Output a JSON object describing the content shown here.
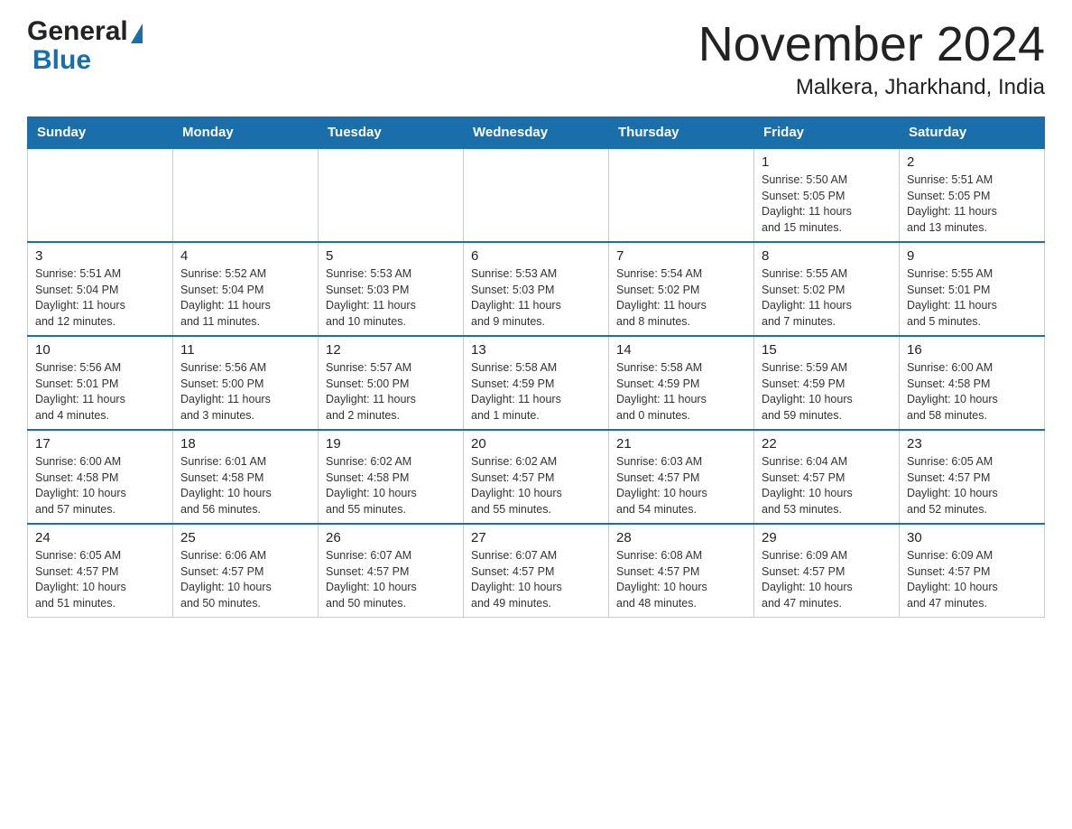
{
  "header": {
    "logo_general": "General",
    "logo_blue": "Blue",
    "main_title": "November 2024",
    "subtitle": "Malkera, Jharkhand, India"
  },
  "weekdays": [
    "Sunday",
    "Monday",
    "Tuesday",
    "Wednesday",
    "Thursday",
    "Friday",
    "Saturday"
  ],
  "weeks": [
    [
      {
        "day": "",
        "info": ""
      },
      {
        "day": "",
        "info": ""
      },
      {
        "day": "",
        "info": ""
      },
      {
        "day": "",
        "info": ""
      },
      {
        "day": "",
        "info": ""
      },
      {
        "day": "1",
        "info": "Sunrise: 5:50 AM\nSunset: 5:05 PM\nDaylight: 11 hours\nand 15 minutes."
      },
      {
        "day": "2",
        "info": "Sunrise: 5:51 AM\nSunset: 5:05 PM\nDaylight: 11 hours\nand 13 minutes."
      }
    ],
    [
      {
        "day": "3",
        "info": "Sunrise: 5:51 AM\nSunset: 5:04 PM\nDaylight: 11 hours\nand 12 minutes."
      },
      {
        "day": "4",
        "info": "Sunrise: 5:52 AM\nSunset: 5:04 PM\nDaylight: 11 hours\nand 11 minutes."
      },
      {
        "day": "5",
        "info": "Sunrise: 5:53 AM\nSunset: 5:03 PM\nDaylight: 11 hours\nand 10 minutes."
      },
      {
        "day": "6",
        "info": "Sunrise: 5:53 AM\nSunset: 5:03 PM\nDaylight: 11 hours\nand 9 minutes."
      },
      {
        "day": "7",
        "info": "Sunrise: 5:54 AM\nSunset: 5:02 PM\nDaylight: 11 hours\nand 8 minutes."
      },
      {
        "day": "8",
        "info": "Sunrise: 5:55 AM\nSunset: 5:02 PM\nDaylight: 11 hours\nand 7 minutes."
      },
      {
        "day": "9",
        "info": "Sunrise: 5:55 AM\nSunset: 5:01 PM\nDaylight: 11 hours\nand 5 minutes."
      }
    ],
    [
      {
        "day": "10",
        "info": "Sunrise: 5:56 AM\nSunset: 5:01 PM\nDaylight: 11 hours\nand 4 minutes."
      },
      {
        "day": "11",
        "info": "Sunrise: 5:56 AM\nSunset: 5:00 PM\nDaylight: 11 hours\nand 3 minutes."
      },
      {
        "day": "12",
        "info": "Sunrise: 5:57 AM\nSunset: 5:00 PM\nDaylight: 11 hours\nand 2 minutes."
      },
      {
        "day": "13",
        "info": "Sunrise: 5:58 AM\nSunset: 4:59 PM\nDaylight: 11 hours\nand 1 minute."
      },
      {
        "day": "14",
        "info": "Sunrise: 5:58 AM\nSunset: 4:59 PM\nDaylight: 11 hours\nand 0 minutes."
      },
      {
        "day": "15",
        "info": "Sunrise: 5:59 AM\nSunset: 4:59 PM\nDaylight: 10 hours\nand 59 minutes."
      },
      {
        "day": "16",
        "info": "Sunrise: 6:00 AM\nSunset: 4:58 PM\nDaylight: 10 hours\nand 58 minutes."
      }
    ],
    [
      {
        "day": "17",
        "info": "Sunrise: 6:00 AM\nSunset: 4:58 PM\nDaylight: 10 hours\nand 57 minutes."
      },
      {
        "day": "18",
        "info": "Sunrise: 6:01 AM\nSunset: 4:58 PM\nDaylight: 10 hours\nand 56 minutes."
      },
      {
        "day": "19",
        "info": "Sunrise: 6:02 AM\nSunset: 4:58 PM\nDaylight: 10 hours\nand 55 minutes."
      },
      {
        "day": "20",
        "info": "Sunrise: 6:02 AM\nSunset: 4:57 PM\nDaylight: 10 hours\nand 55 minutes."
      },
      {
        "day": "21",
        "info": "Sunrise: 6:03 AM\nSunset: 4:57 PM\nDaylight: 10 hours\nand 54 minutes."
      },
      {
        "day": "22",
        "info": "Sunrise: 6:04 AM\nSunset: 4:57 PM\nDaylight: 10 hours\nand 53 minutes."
      },
      {
        "day": "23",
        "info": "Sunrise: 6:05 AM\nSunset: 4:57 PM\nDaylight: 10 hours\nand 52 minutes."
      }
    ],
    [
      {
        "day": "24",
        "info": "Sunrise: 6:05 AM\nSunset: 4:57 PM\nDaylight: 10 hours\nand 51 minutes."
      },
      {
        "day": "25",
        "info": "Sunrise: 6:06 AM\nSunset: 4:57 PM\nDaylight: 10 hours\nand 50 minutes."
      },
      {
        "day": "26",
        "info": "Sunrise: 6:07 AM\nSunset: 4:57 PM\nDaylight: 10 hours\nand 50 minutes."
      },
      {
        "day": "27",
        "info": "Sunrise: 6:07 AM\nSunset: 4:57 PM\nDaylight: 10 hours\nand 49 minutes."
      },
      {
        "day": "28",
        "info": "Sunrise: 6:08 AM\nSunset: 4:57 PM\nDaylight: 10 hours\nand 48 minutes."
      },
      {
        "day": "29",
        "info": "Sunrise: 6:09 AM\nSunset: 4:57 PM\nDaylight: 10 hours\nand 47 minutes."
      },
      {
        "day": "30",
        "info": "Sunrise: 6:09 AM\nSunset: 4:57 PM\nDaylight: 10 hours\nand 47 minutes."
      }
    ]
  ]
}
